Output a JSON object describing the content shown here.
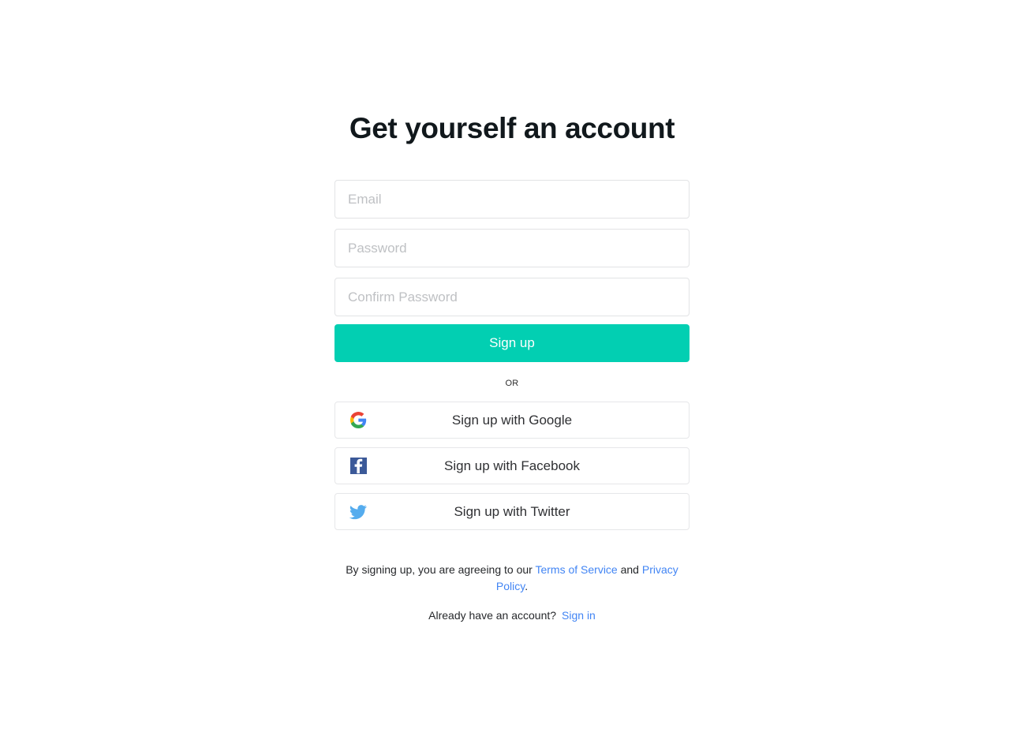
{
  "page": {
    "title": "Get yourself an account",
    "background_color": "#ffffff"
  },
  "form": {
    "fields": [
      {
        "name": "email",
        "placeholder": "Email",
        "value": "",
        "type": "email"
      },
      {
        "name": "password",
        "placeholder": "Password",
        "value": "",
        "type": "password"
      },
      {
        "name": "confirm_password",
        "placeholder": "Confirm Password",
        "value": "",
        "type": "password"
      }
    ],
    "submit_label": "Sign up",
    "submit_color": "#02cfb2",
    "separator_label": "OR"
  },
  "social": {
    "buttons": [
      {
        "icon": "google-icon",
        "label": "Sign up with Google"
      },
      {
        "icon": "facebook-icon",
        "label": "Sign up with Facebook"
      },
      {
        "icon": "twitter-icon",
        "label": "Sign up with Twitter"
      }
    ]
  },
  "legal": {
    "prefix": "By signing up, you are agreeing to our ",
    "terms_link": "Terms of Service",
    "conjunction": " and ",
    "privacy_link": "Privacy Policy",
    "suffix": ".",
    "link_color": "#4285f4"
  },
  "signin": {
    "prompt": "Already have an account?",
    "link_label": "Sign in"
  }
}
